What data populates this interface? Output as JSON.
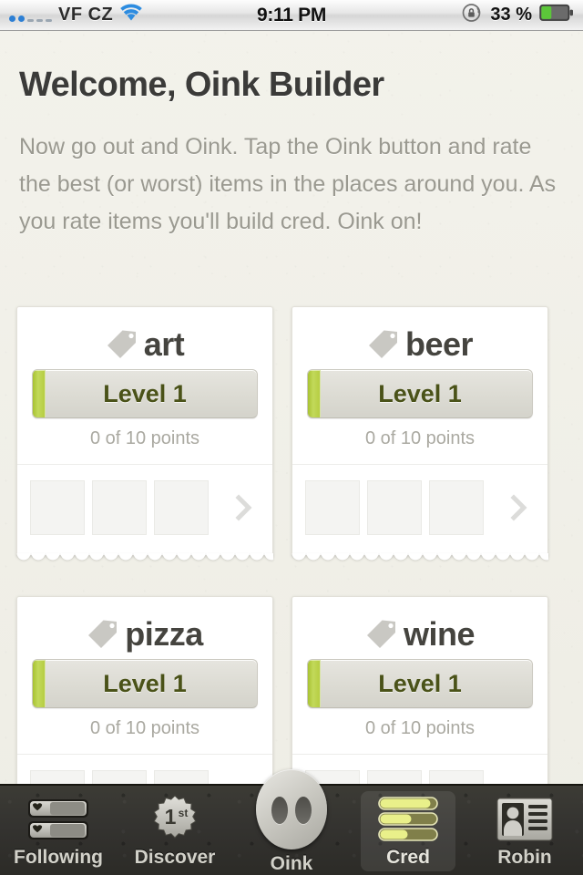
{
  "status_bar": {
    "carrier": "VF CZ",
    "time": "9:11 PM",
    "battery_percent": "33 %",
    "signal_filled": 2,
    "signal_empty": 3,
    "wifi_icon": "wifi-icon",
    "rotation_lock_icon": "rotation-lock-icon",
    "battery_icon": "battery-icon",
    "battery_level": 33,
    "battery_color": "#5cc63a"
  },
  "header": {
    "title": "Welcome, Oink Builder",
    "intro": "Now go out and Oink. Tap the Oink button and rate the best (or worst) items in the places around you.  As you rate items you'll build cred. Oink on!"
  },
  "cards": [
    {
      "name": "art",
      "tag_icon": "tag-icon",
      "level": "Level 1",
      "points": "0 of 10 points",
      "progress_percent": 0,
      "thumbs": 3,
      "chevron_icon": "chevron-right-icon",
      "show_footer": true
    },
    {
      "name": "beer",
      "tag_icon": "tag-icon",
      "level": "Level 1",
      "points": "0 of 10 points",
      "progress_percent": 0,
      "thumbs": 3,
      "chevron_icon": "chevron-right-icon",
      "show_footer": true
    },
    {
      "name": "pizza",
      "tag_icon": "tag-icon",
      "level": "Level 1",
      "points": "0 of 10 points",
      "progress_percent": 0,
      "thumbs": 3,
      "chevron_icon": "chevron-right-icon",
      "show_footer": true
    },
    {
      "name": "wine",
      "tag_icon": "tag-icon",
      "level": "Level 1",
      "points": "0 of 10 points",
      "progress_percent": 0,
      "thumbs": 3,
      "chevron_icon": "chevron-right-icon",
      "show_footer": true
    }
  ],
  "tabbar": {
    "items": [
      {
        "label": "Following",
        "icon": "following-list-icon",
        "active": false
      },
      {
        "label": "Discover",
        "icon": "first-place-badge-icon",
        "active": false
      },
      {
        "label": "Oink",
        "icon": "pig-snout-icon",
        "active": false
      },
      {
        "label": "Cred",
        "icon": "cred-bars-icon",
        "active": true
      },
      {
        "label": "Robin",
        "icon": "id-card-icon",
        "active": false
      }
    ],
    "cred_bar_fills": [
      88,
      55,
      48
    ]
  },
  "colors": {
    "accent_green": "#b6cd42",
    "level_text": "#4a5218",
    "page_bg": "#f2f1ea",
    "title": "#3b3b39",
    "body_text": "#9a9990",
    "tabbar_bg": "#343330"
  }
}
